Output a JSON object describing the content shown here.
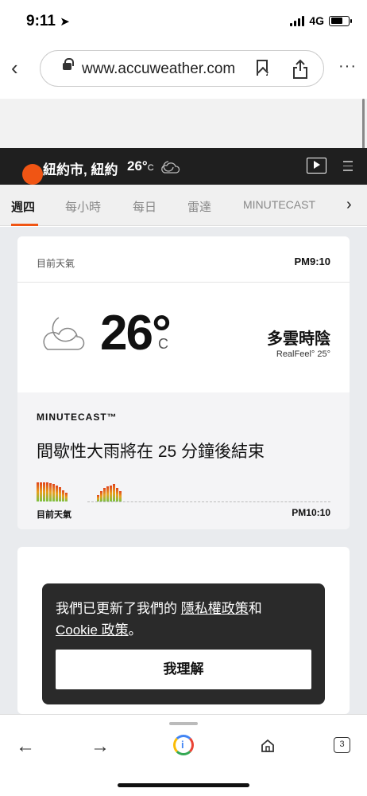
{
  "status": {
    "time": "9:11",
    "network": "4G"
  },
  "browser": {
    "url": "www.accuweather.com",
    "more": "···",
    "open_tabs": "3"
  },
  "site_header": {
    "location": "紐約市, 紐約",
    "temp": "26°",
    "unit": "C"
  },
  "tabs": {
    "items": [
      "週四",
      "每小時",
      "每日",
      "雷達",
      "MINUTECAST"
    ],
    "active": "週四",
    "next_arrow": "›"
  },
  "current": {
    "label": "目前天氣",
    "time": "PM9:10",
    "temp": "26°",
    "unit": "C",
    "condition": "多雲時陰",
    "realfeel": "RealFeel° 25°",
    "icon": "moon-cloud-icon"
  },
  "minutecast": {
    "title": "MINUTECAST™",
    "message": "間歇性大雨將在 25 分鐘後結束",
    "start_label": "目前天氣",
    "end_label": "PM10:10",
    "intensity": [
      1.0,
      1.0,
      1.0,
      1.0,
      0.95,
      0.9,
      0.85,
      0.75,
      0.6,
      0.45,
      0,
      0,
      0,
      0,
      0,
      0,
      0,
      0,
      0,
      0.35,
      0.55,
      0.7,
      0.8,
      0.85,
      0.9,
      0.7,
      0.55
    ]
  },
  "toast": {
    "text_before": "我們已更新了我們的 ",
    "privacy_link": "隱私權政策",
    "and": "和",
    "cookie_link": "Cookie 政策",
    "text_after": "。",
    "button": "我理解"
  },
  "colors": {
    "accent": "#f05514",
    "header_bg": "#1f1f1f"
  }
}
